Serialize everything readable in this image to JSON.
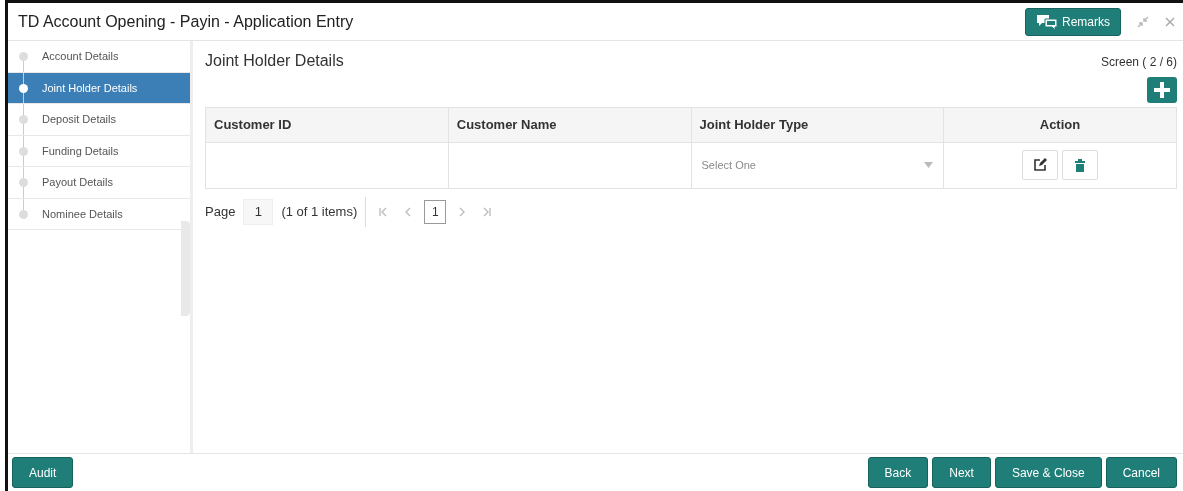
{
  "window": {
    "title": "TD Account Opening - Payin - Application Entry"
  },
  "header_buttons": {
    "remarks": "Remarks"
  },
  "sidebar": {
    "items": [
      {
        "label": "Account Details",
        "selected": false
      },
      {
        "label": "Joint Holder Details",
        "selected": true
      },
      {
        "label": "Deposit Details",
        "selected": false
      },
      {
        "label": "Funding Details",
        "selected": false
      },
      {
        "label": "Payout Details",
        "selected": false
      },
      {
        "label": "Nominee Details",
        "selected": false
      }
    ]
  },
  "section": {
    "title": "Joint Holder Details",
    "screen_counter": "Screen ( 2 / 6)"
  },
  "table": {
    "columns": [
      "Customer ID",
      "Customer Name",
      "Joint Holder Type",
      "Action"
    ],
    "rows": [
      {
        "customer_id": "",
        "customer_name": "",
        "joint_holder_type": {
          "placeholder": "Select One"
        }
      }
    ]
  },
  "pager": {
    "label": "Page",
    "page": "1",
    "summary": "(1 of 1 items)",
    "current": "1"
  },
  "footer": {
    "left": [
      "Audit"
    ],
    "right": [
      "Back",
      "Next",
      "Save & Close",
      "Cancel"
    ]
  }
}
